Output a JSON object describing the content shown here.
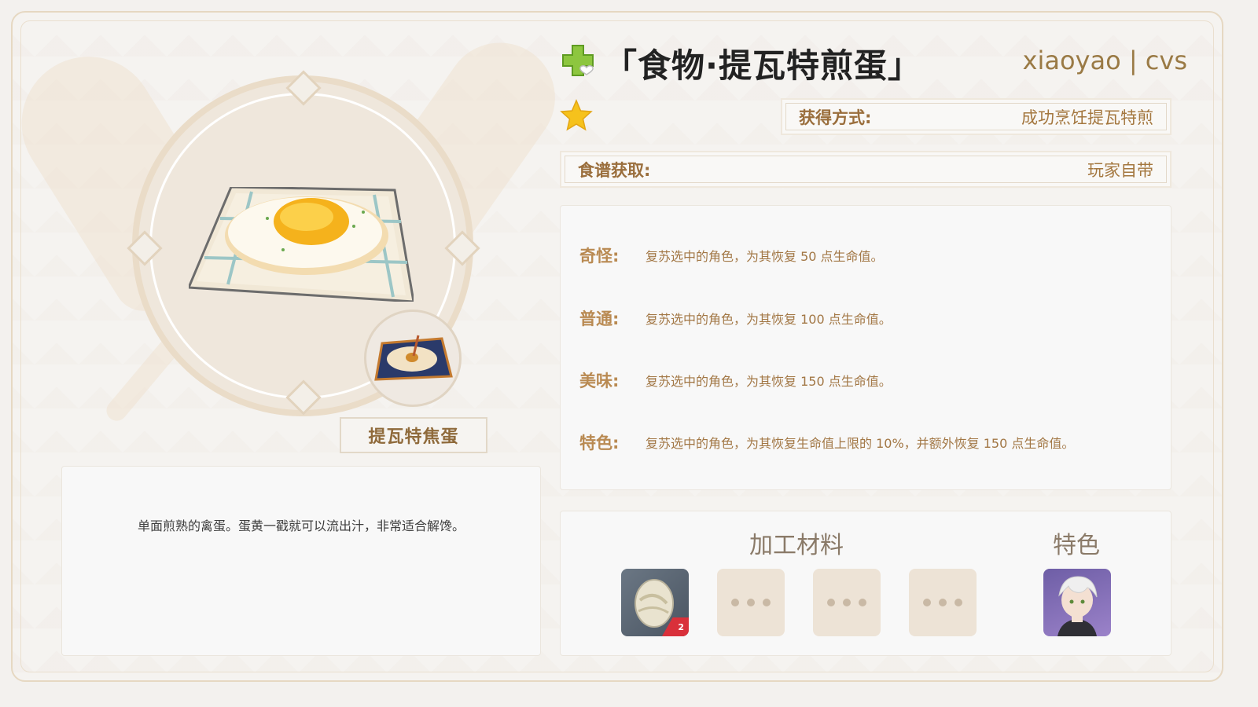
{
  "header": {
    "title": "「食物·提瓦特煎蛋」",
    "author": "xiaoyao | cvs"
  },
  "icons": {
    "plus": "heal-plus-icon",
    "star": "star-icon",
    "accent": "#a4773f"
  },
  "dish": {
    "special_name": "提瓦特焦蛋",
    "description": "单面煎熟的禽蛋。蛋黄一戳就可以流出汁，非常适合解馋。"
  },
  "info": {
    "obtain_label": "获得方式:",
    "obtain_value": "成功烹饪提瓦特煎",
    "recipe_label": "食谱获取:",
    "recipe_value": "玩家自带"
  },
  "effects": [
    {
      "label": "奇怪:",
      "text": "复苏选中的角色，为其恢复 50 点生命值。"
    },
    {
      "label": "普通:",
      "text": "复苏选中的角色，为其恢复 100 点生命值。"
    },
    {
      "label": "美味:",
      "text": "复苏选中的角色，为其恢复 150 点生命值。"
    },
    {
      "label": "特色:",
      "text": "复苏选中的角色，为其恢复生命值上限的 10%，并额外恢复 150 点生命值。"
    }
  ],
  "ingredients": {
    "title": "加工材料",
    "special_title": "特色",
    "egg_count": "2"
  }
}
